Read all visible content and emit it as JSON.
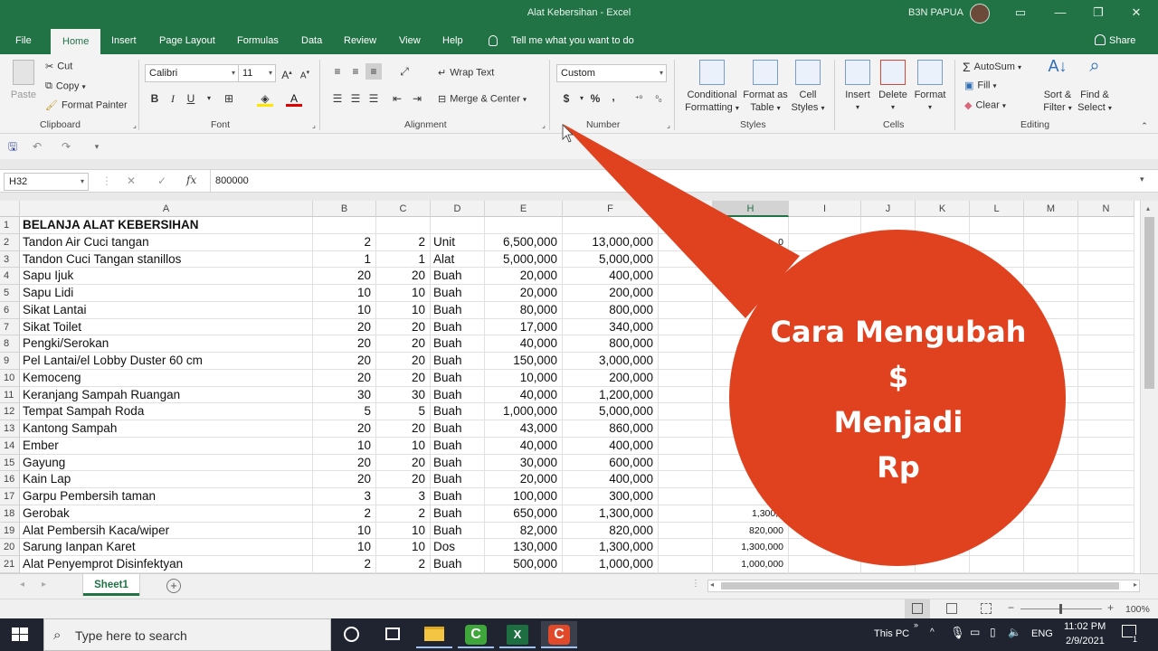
{
  "window": {
    "title": "Alat Kebersihan  -  Excel",
    "user": "B3N PAPUA"
  },
  "tabs": [
    "File",
    "Home",
    "Insert",
    "Page Layout",
    "Formulas",
    "Data",
    "Review",
    "View",
    "Help"
  ],
  "tell_me": "Tell me what you want to do",
  "share": "Share",
  "ribbon": {
    "clipboard": {
      "paste": "Paste",
      "cut": "Cut",
      "copy": "Copy",
      "format_painter": "Format Painter",
      "label": "Clipboard"
    },
    "font": {
      "name": "Calibri",
      "size": "11",
      "label": "Font",
      "bold": "B",
      "italic": "I",
      "underline": "U"
    },
    "alignment": {
      "wrap_text": "Wrap Text",
      "merge_center": "Merge & Center",
      "label": "Alignment"
    },
    "number": {
      "format": "Custom",
      "label": "Number",
      "currency": "$",
      "percent": "%",
      "comma": ","
    },
    "styles": {
      "conditional": "Conditional",
      "formatting": "Formatting",
      "format_as": "Format as",
      "table": "Table",
      "cell": "Cell",
      "styles": "Styles",
      "label": "Styles"
    },
    "cells": {
      "insert": "Insert",
      "delete": "Delete",
      "format": "Format",
      "label": "Cells"
    },
    "editing": {
      "autosum": "AutoSum",
      "fill": "Fill",
      "clear": "Clear",
      "sort_filter": "Sort &",
      "filter": "Filter",
      "find_select": "Find &",
      "select": "Select",
      "label": "Editing"
    }
  },
  "formula_bar": {
    "name_box": "H32",
    "fx": "fx",
    "value": "800000"
  },
  "columns": [
    "A",
    "B",
    "C",
    "D",
    "E",
    "F",
    "G",
    "H",
    "I",
    "J",
    "K",
    "L",
    "M",
    "N"
  ],
  "rows": [
    {
      "n": "1",
      "a": "BELANJA ALAT KEBERSIHAN",
      "b": "",
      "c": "",
      "d": "",
      "e": "",
      "f": "",
      "h": ""
    },
    {
      "n": "2",
      "a": "Tandon Air Cuci tangan",
      "b": "2",
      "c": "2",
      "d": "Unit",
      "e": "6,500,000",
      "f": "13,000,000",
      "h": "0"
    },
    {
      "n": "3",
      "a": "Tandon Cuci Tangan stanillos",
      "b": "1",
      "c": "1",
      "d": "Alat",
      "e": "5,000,000",
      "f": "5,000,000",
      "h": ""
    },
    {
      "n": "4",
      "a": "Sapu Ijuk",
      "b": "20",
      "c": "20",
      "d": "Buah",
      "e": "20,000",
      "f": "400,000",
      "h": ""
    },
    {
      "n": "5",
      "a": "Sapu Lidi",
      "b": "10",
      "c": "10",
      "d": "Buah",
      "e": "20,000",
      "f": "200,000",
      "h": ""
    },
    {
      "n": "6",
      "a": "Sikat Lantai",
      "b": "10",
      "c": "10",
      "d": "Buah",
      "e": "80,000",
      "f": "800,000",
      "h": ""
    },
    {
      "n": "7",
      "a": "Sikat Toilet",
      "b": "20",
      "c": "20",
      "d": "Buah",
      "e": "17,000",
      "f": "340,000",
      "h": ""
    },
    {
      "n": "8",
      "a": "Pengki/Serokan",
      "b": "20",
      "c": "20",
      "d": "Buah",
      "e": "40,000",
      "f": "800,000",
      "h": ""
    },
    {
      "n": "9",
      "a": "Pel Lantai/el Lobby Duster 60 cm",
      "b": "20",
      "c": "20",
      "d": "Buah",
      "e": "150,000",
      "f": "3,000,000",
      "h": ""
    },
    {
      "n": "10",
      "a": "Kemoceng",
      "b": "20",
      "c": "20",
      "d": "Buah",
      "e": "10,000",
      "f": "200,000",
      "h": ""
    },
    {
      "n": "11",
      "a": "Keranjang Sampah Ruangan",
      "b": "30",
      "c": "30",
      "d": "Buah",
      "e": "40,000",
      "f": "1,200,000",
      "h": ""
    },
    {
      "n": "12",
      "a": "Tempat Sampah Roda",
      "b": "5",
      "c": "5",
      "d": "Buah",
      "e": "1,000,000",
      "f": "5,000,000",
      "h": ""
    },
    {
      "n": "13",
      "a": "Kantong Sampah",
      "b": "20",
      "c": "20",
      "d": "Buah",
      "e": "43,000",
      "f": "860,000",
      "h": ""
    },
    {
      "n": "14",
      "a": "Ember",
      "b": "10",
      "c": "10",
      "d": "Buah",
      "e": "40,000",
      "f": "400,000",
      "h": ""
    },
    {
      "n": "15",
      "a": "Gayung",
      "b": "20",
      "c": "20",
      "d": "Buah",
      "e": "30,000",
      "f": "600,000",
      "h": ""
    },
    {
      "n": "16",
      "a": "Kain Lap",
      "b": "20",
      "c": "20",
      "d": "Buah",
      "e": "20,000",
      "f": "400,000",
      "h": ""
    },
    {
      "n": "17",
      "a": "Garpu Pembersih taman",
      "b": "3",
      "c": "3",
      "d": "Buah",
      "e": "100,000",
      "f": "300,000",
      "h": "30"
    },
    {
      "n": "18",
      "a": "Gerobak",
      "b": "2",
      "c": "2",
      "d": "Buah",
      "e": "650,000",
      "f": "1,300,000",
      "h": "1,300,0"
    },
    {
      "n": "19",
      "a": "Alat Pembersih Kaca/wiper",
      "b": "10",
      "c": "10",
      "d": "Buah",
      "e": "82,000",
      "f": "820,000",
      "h": "820,000"
    },
    {
      "n": "20",
      "a": "Sarung Ianpan Karet",
      "b": "10",
      "c": "10",
      "d": "Dos",
      "e": "130,000",
      "f": "1,300,000",
      "h": "1,300,000"
    },
    {
      "n": "21",
      "a": "Alat Penyemprot Disinfektyan",
      "b": "2",
      "c": "2",
      "d": "Buah",
      "e": "500,000",
      "f": "1,000,000",
      "h": "1,000,000"
    }
  ],
  "sheet_tab": "Sheet1",
  "status": {
    "zoom": "100%"
  },
  "callout_lines": [
    "Cara Mengubah",
    "$",
    "Menjadi",
    "Rp"
  ],
  "taskbar": {
    "search_placeholder": "Type here to search",
    "this_pc": "This PC",
    "lang": "ENG",
    "time": "11:02 PM",
    "date": "2/9/2021",
    "notification_count": "1"
  },
  "colors": {
    "excel_green": "#217346",
    "callout": "#e0421f"
  }
}
